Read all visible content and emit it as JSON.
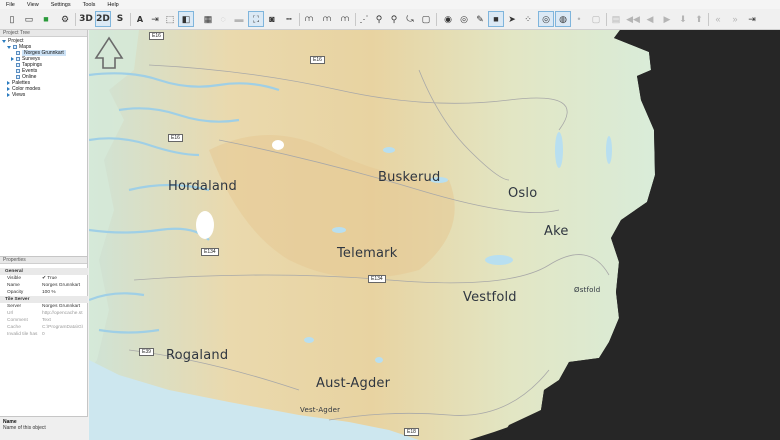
{
  "menu": [
    "File",
    "View",
    "Settings",
    "Tools",
    "Help"
  ],
  "toolbar": {
    "btn_3d": "3D",
    "btn_2d": "2D",
    "btn_s": "S",
    "btn_a": "A"
  },
  "tree": {
    "title": "Project Tree",
    "root": "Project",
    "maps": "Maps",
    "norges": "Norges Grunnkart",
    "surveys": "Surveys",
    "tappings": "Tappings",
    "events": "Events",
    "online": "Online",
    "palettes": "Palettes",
    "color_modes": "Color modes",
    "views": "Views"
  },
  "properties": {
    "title": "Properties",
    "rows": [
      {
        "k": "General",
        "v": "",
        "cat": true
      },
      {
        "k": "Visible",
        "v": "✔  True"
      },
      {
        "k": "Name",
        "v": "Norges Grunnkart"
      },
      {
        "k": "Opacity",
        "v": "100 %"
      },
      {
        "k": "Tile Server",
        "v": "",
        "cat": true
      },
      {
        "k": "Server",
        "v": "Norges Grunnkart"
      },
      {
        "k": "Url",
        "v": "http://opencache.st",
        "ro": true
      },
      {
        "k": "Comment",
        "v": "Text",
        "ro": true
      },
      {
        "k": "Cache",
        "v": "C:\\ProgramData\\G\\",
        "ro": true
      },
      {
        "k": "Invalid tile has",
        "v": "0",
        "ro": true
      }
    ],
    "desc_title": "Name",
    "desc_text": "Name of this object"
  },
  "map": {
    "labels": {
      "hordaland": "Hordaland",
      "buskerud": "Buskerud",
      "oslo": "Oslo",
      "ake": "Ake",
      "telemark": "Telemark",
      "vestfold": "Vestfold",
      "rogaland": "Rogaland",
      "aust_agder": "Aust-Agder",
      "vest_agder": "Vest-Agder",
      "ostfold": "Østfold"
    },
    "shields": {
      "e16a": "E16",
      "e16b": "E16",
      "e16c": "E16",
      "e134a": "E134",
      "e134b": "E134",
      "e39": "E39",
      "e18": "E18"
    }
  }
}
